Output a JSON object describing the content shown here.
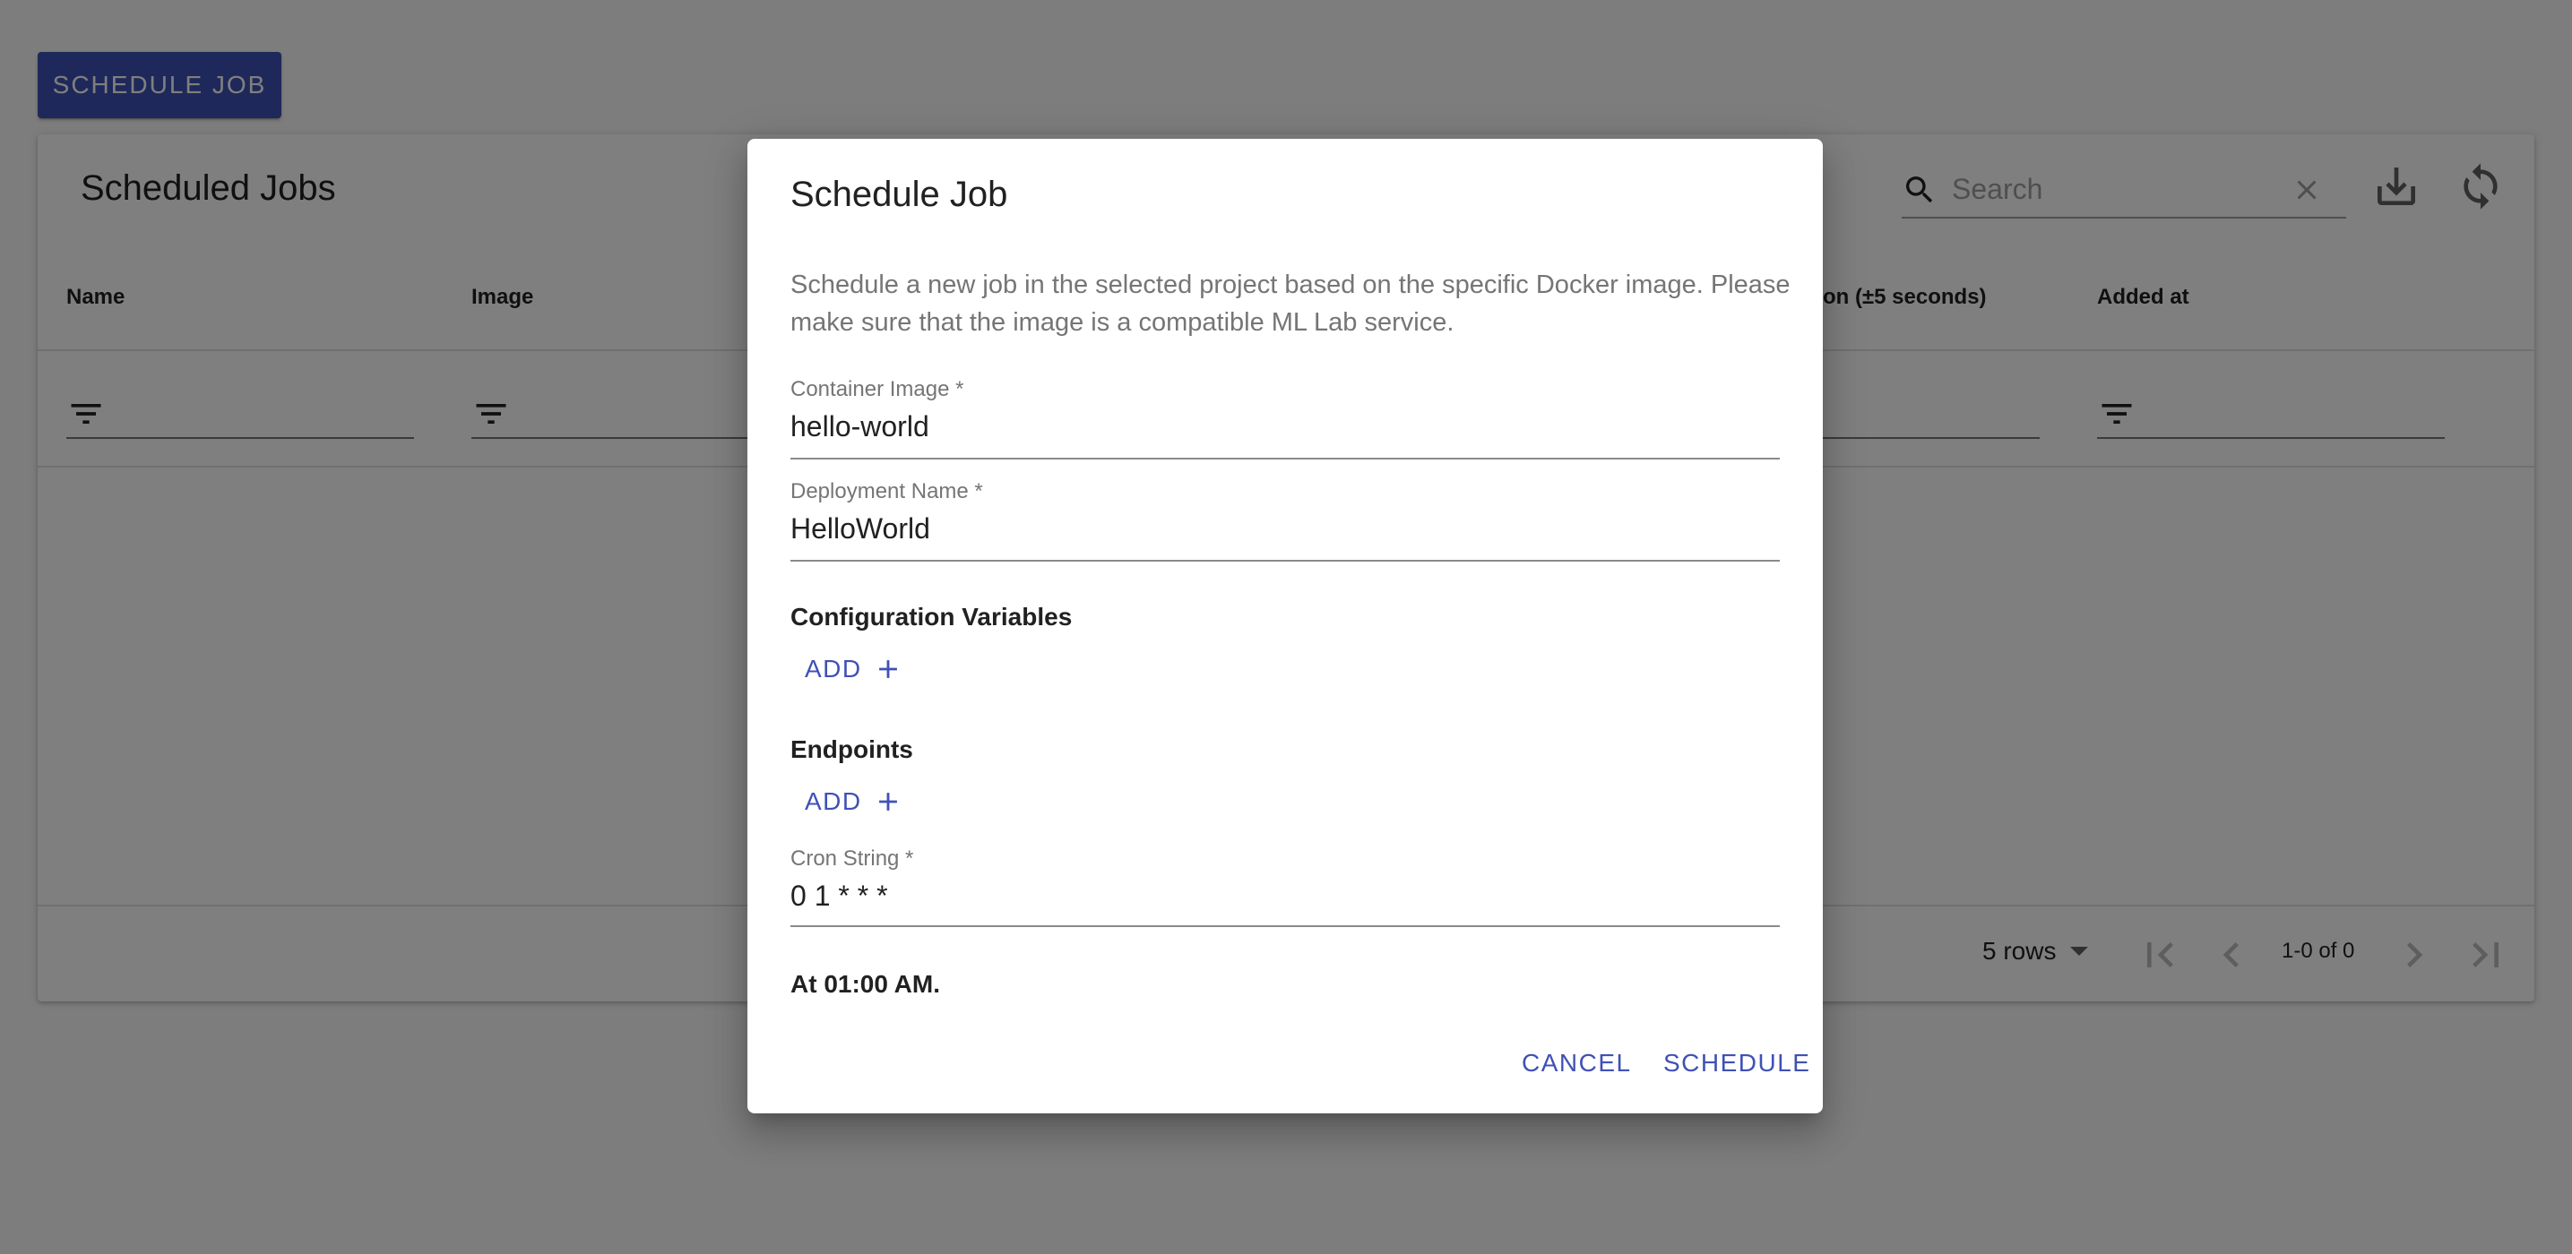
{
  "page": {
    "schedule_job_button": "SCHEDULE JOB"
  },
  "table": {
    "title": "Scheduled Jobs",
    "search_placeholder": "Search",
    "columns": [
      "Name",
      "Image",
      "on (±5 seconds)",
      "Added at"
    ],
    "rows_per_page": "5 rows",
    "page_info": "1-0 of 0"
  },
  "dialog": {
    "title": "Schedule Job",
    "description": "Schedule a new job in the selected project based on the specific Docker image. Please make sure that the image is a compatible ML Lab service.",
    "container_image": {
      "label": "Container Image *",
      "value": "hello-world"
    },
    "deployment_name": {
      "label": "Deployment Name *",
      "value": "HelloWorld"
    },
    "config_vars": {
      "title": "Configuration Variables",
      "add_label": "ADD"
    },
    "endpoints": {
      "title": "Endpoints",
      "add_label": "ADD"
    },
    "cron_string": {
      "label": "Cron String *",
      "value": "0 1 * * *"
    },
    "cron_description": "At 01:00 AM.",
    "cancel_label": "CANCEL",
    "schedule_label": "SCHEDULE"
  },
  "colors": {
    "primary": "#3f51b5",
    "scrim": "rgba(0,0,0,0.5)"
  },
  "icons": [
    "search-icon",
    "clear-icon",
    "download-icon",
    "refresh-icon",
    "filter-icon",
    "add-icon",
    "first-page-icon",
    "prev-page-icon",
    "next-page-icon",
    "last-page-icon",
    "dropdown-caret-icon"
  ]
}
